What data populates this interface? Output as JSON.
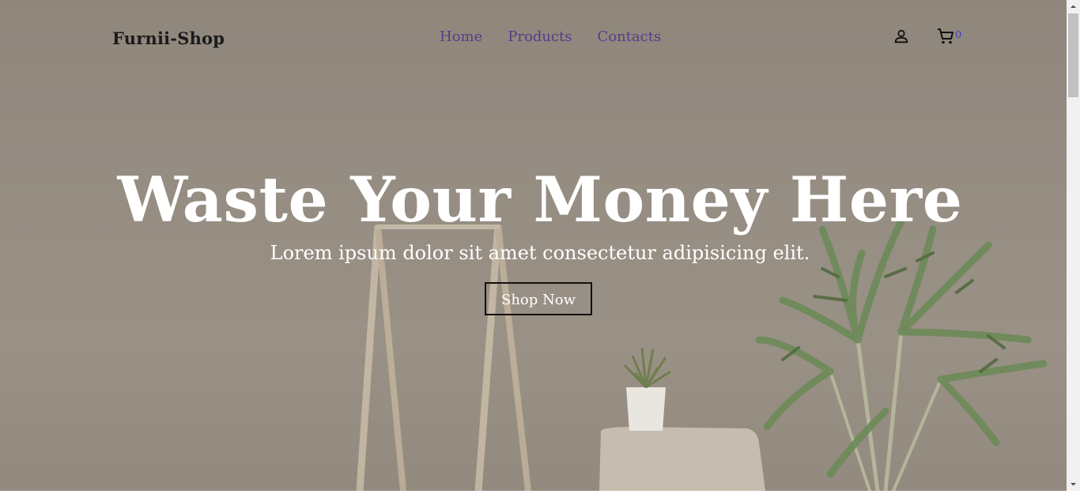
{
  "brand": "Furnii-Shop",
  "nav": [
    {
      "label": "Home"
    },
    {
      "label": "Products"
    },
    {
      "label": "Contacts"
    }
  ],
  "icons": {
    "user": "person-icon",
    "cart": "shopping-cart-icon"
  },
  "cart_count": "0",
  "hero": {
    "title": "Waste Your Money Here",
    "subtitle": "Lorem ipsum dolor sit amet consectetur adipisicing elit.",
    "cta": "Shop Now"
  },
  "colors": {
    "nav_link": "#5b3a8c",
    "cart_count": "#3d3ac7",
    "hero_text": "#ffffff",
    "brand": "#1b1b1b"
  }
}
